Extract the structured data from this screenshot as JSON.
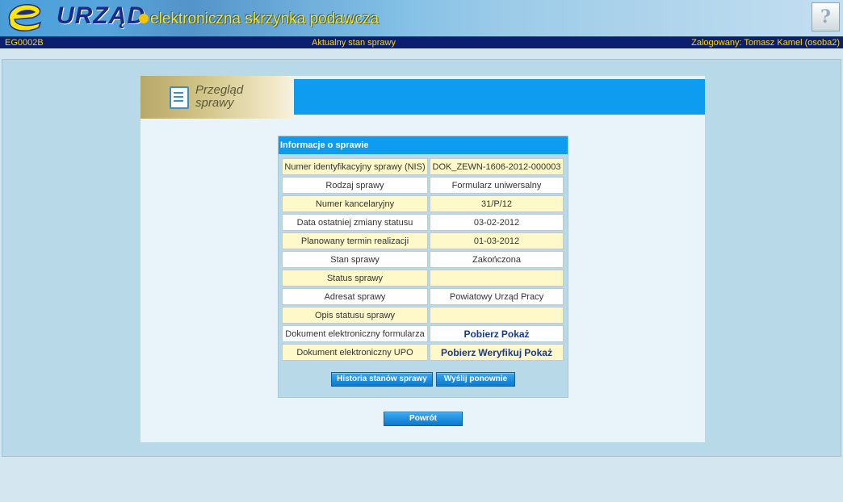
{
  "header": {
    "logo_text": "URZĄD",
    "logo_subtitle": "elektroniczna skrzynka podawcza",
    "help_glyph": "?"
  },
  "statusbar": {
    "code": "EG0002B",
    "title": "Aktualny stan sprawy",
    "user": "Zalogowany: Tomasz Kamel (osoba2)"
  },
  "panel": {
    "title_line1": "Przegląd",
    "title_line2": "sprawy"
  },
  "info": {
    "title": "Informacje o sprawie",
    "rows": [
      {
        "label": "Numer identyfikacyjny sprawy (NIS)",
        "value": "DOK_ZEWN-1606-2012-000003"
      },
      {
        "label": "Rodzaj sprawy",
        "value": "Formularz uniwersalny"
      },
      {
        "label": "Numer kancelaryjny",
        "value": "31/P/12"
      },
      {
        "label": "Data ostatniej zmiany statusu",
        "value": "03-02-2012"
      },
      {
        "label": "Planowany termin realizacji",
        "value": "01-03-2012"
      },
      {
        "label": "Stan sprawy",
        "value": "Zakończona"
      },
      {
        "label": "Status sprawy",
        "value": ""
      },
      {
        "label": "Adresat sprawy",
        "value": "Powiatowy Urząd Pracy"
      },
      {
        "label": "Opis statusu sprawy",
        "value": ""
      },
      {
        "label": "Dokument elektroniczny formularza",
        "links": [
          "Pobierz",
          "Pokaż"
        ]
      },
      {
        "label": "Dokument elektroniczny UPO",
        "links": [
          "Pobierz",
          "Weryfikuj",
          "Pokaż"
        ]
      }
    ]
  },
  "buttons": {
    "history": "Historia stanów sprawy",
    "resend": "Wyślij ponownie",
    "back": "Powrót"
  },
  "colors": {
    "accent": "#0d9cf0",
    "statusbar_bg": "#0b1f6e",
    "statusbar_text": "#ffd800",
    "row_highlight": "#fff8c8"
  }
}
